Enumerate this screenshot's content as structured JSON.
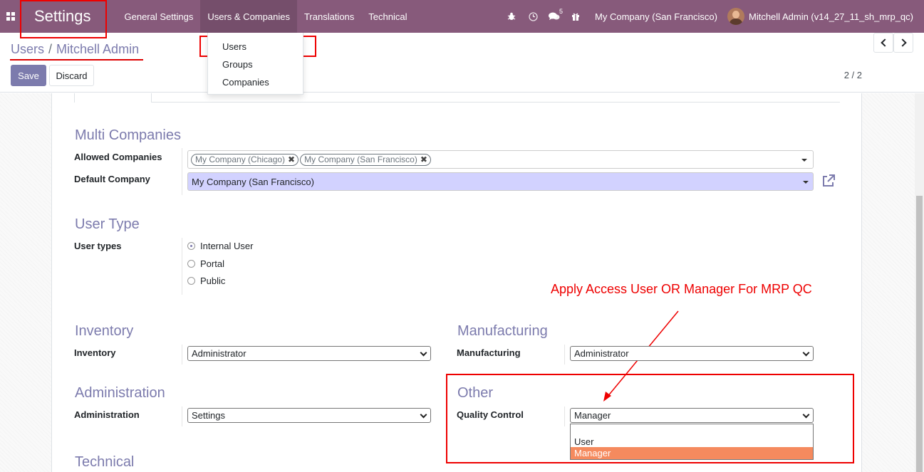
{
  "navbar": {
    "app_name": "Settings",
    "menu": [
      {
        "label": "General Settings"
      },
      {
        "label": "Users & Companies"
      },
      {
        "label": "Translations"
      },
      {
        "label": "Technical"
      }
    ],
    "messages_count": "5",
    "company": "My Company (San Francisco)",
    "user": "Mitchell Admin (v14_27_11_sh_mrp_qc)"
  },
  "dropdown": {
    "items": [
      {
        "label": "Users"
      },
      {
        "label": "Groups"
      },
      {
        "label": "Companies"
      }
    ]
  },
  "breadcrumb": {
    "parent": "Users",
    "separator": "/",
    "current": "Mitchell Admin"
  },
  "buttons": {
    "save": "Save",
    "discard": "Discard"
  },
  "pager": {
    "value": "2 / 2"
  },
  "form": {
    "multi_companies": {
      "title": "Multi Companies",
      "allowed_label": "Allowed Companies",
      "allowed_tags": [
        "My Company (Chicago)",
        "My Company (San Francisco)"
      ],
      "default_label": "Default Company",
      "default_value": "My Company (San Francisco)"
    },
    "user_type": {
      "title": "User Type",
      "label": "User types",
      "options": [
        "Internal User",
        "Portal",
        "Public"
      ],
      "selected": "Internal User"
    },
    "inventory": {
      "title": "Inventory",
      "label": "Inventory",
      "value": "Administrator"
    },
    "manufacturing": {
      "title": "Manufacturing",
      "label": "Manufacturing",
      "value": "Administrator"
    },
    "administration": {
      "title": "Administration",
      "label": "Administration",
      "value": "Settings"
    },
    "other": {
      "title": "Other",
      "label": "Quality Control",
      "value": "Manager",
      "options": [
        "",
        "User",
        "Manager"
      ],
      "highlighted": "Manager"
    },
    "technical": {
      "title": "Technical"
    }
  },
  "annotation": {
    "text": "Apply Access User OR Manager For MRP QC",
    "color": "#ee0000"
  },
  "colors": {
    "navbar": "#875a7b",
    "accent": "#7c7bad",
    "option_highlight": "#f58a5e"
  }
}
